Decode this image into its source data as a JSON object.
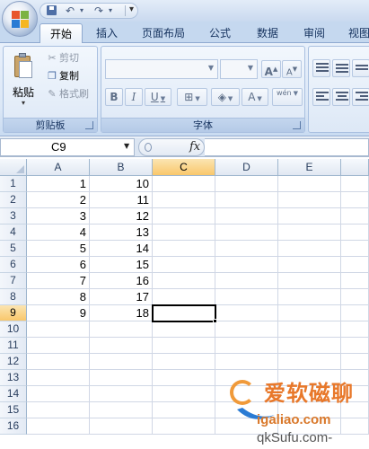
{
  "quick_access": {
    "undo_glyph": "↶",
    "redo_glyph": "↷",
    "dropdown_glyph": "▾",
    "customize_glyph": "▾"
  },
  "ribbon_tabs": [
    {
      "label": "开始",
      "active": true
    },
    {
      "label": "插入",
      "active": false
    },
    {
      "label": "页面布局",
      "active": false
    },
    {
      "label": "公式",
      "active": false
    },
    {
      "label": "数据",
      "active": false
    },
    {
      "label": "审阅",
      "active": false
    },
    {
      "label": "视图",
      "active": false
    }
  ],
  "clipboard": {
    "paste_label": "粘贴",
    "cut_label": "剪切",
    "copy_label": "复制",
    "format_painter_label": "格式刷",
    "group_label": "剪贴板"
  },
  "font_group": {
    "grow_glyph": "A",
    "shrink_glyph": "A",
    "bold": "B",
    "italic": "I",
    "underline": "U",
    "font_color_glyph": "A",
    "wen_glyph": "wén",
    "group_label": "字体"
  },
  "formula_bar": {
    "name_box_value": "C9",
    "fx_label": "fx",
    "formula_value": ""
  },
  "sheet": {
    "columns": [
      "A",
      "B",
      "C",
      "D",
      "E"
    ],
    "rows": [
      "1",
      "2",
      "3",
      "4",
      "5",
      "6",
      "7",
      "8",
      "9",
      "10",
      "11",
      "12",
      "13",
      "14",
      "15",
      "16"
    ],
    "active_cell": "C9",
    "cells": {
      "A": [
        "1",
        "2",
        "3",
        "4",
        "5",
        "6",
        "7",
        "8",
        "9",
        "",
        "",
        "",
        "",
        "",
        "",
        ""
      ],
      "B": [
        "10",
        "11",
        "12",
        "13",
        "14",
        "15",
        "16",
        "17",
        "18",
        "",
        "",
        "",
        "",
        "",
        "",
        ""
      ]
    }
  },
  "watermark": {
    "brand": "爱软磁聊",
    "url": "igaliao.com",
    "sub": "qkSufu.com-"
  },
  "colors": {
    "ribbon": "#dbe7f6",
    "active_header": "#f9c76b",
    "gridline": "#d0d7e5",
    "watermark": "#e8782a"
  }
}
